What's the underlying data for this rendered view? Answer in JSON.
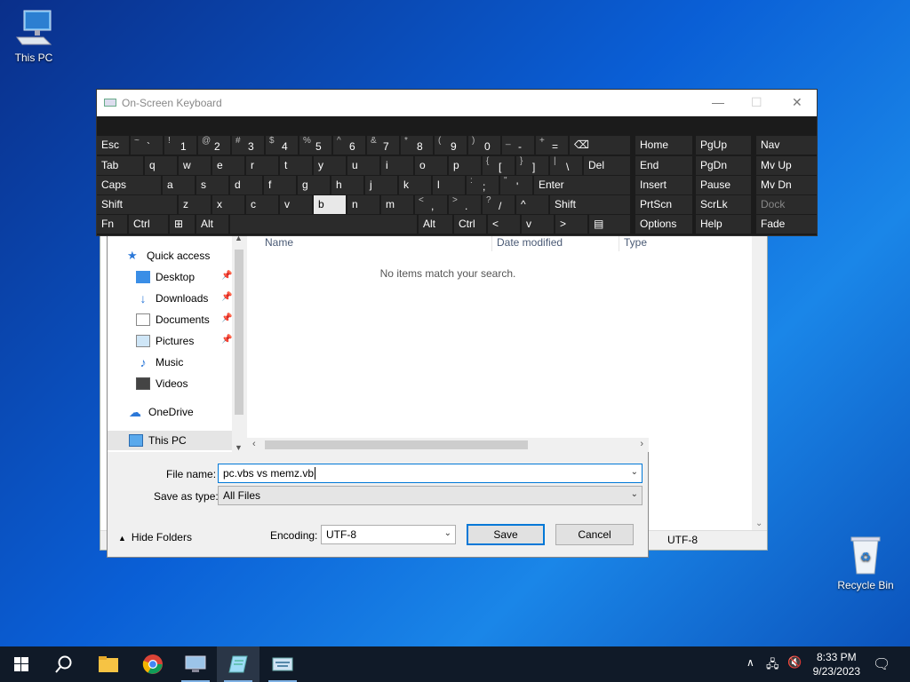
{
  "desktop": {
    "this_pc_label": "This PC",
    "recycle_bin_label": "Recycle Bin"
  },
  "notepad": {
    "encoding": "UTF-8"
  },
  "dialog": {
    "columns": {
      "name": "Name",
      "date_modified": "Date modified",
      "type": "Type"
    },
    "empty_message": "No items match your search.",
    "nav": {
      "quick_access": "Quick access",
      "desktop": "Desktop",
      "downloads": "Downloads",
      "documents": "Documents",
      "pictures": "Pictures",
      "music": "Music",
      "videos": "Videos",
      "onedrive": "OneDrive",
      "this_pc": "This PC"
    },
    "file_name_label": "File name:",
    "file_name_value": "pc.vbs vs memz.vb",
    "save_as_type_label": "Save as type:",
    "save_as_type_value": "All Files",
    "hide_folders": "Hide Folders",
    "encoding_label": "Encoding:",
    "encoding_value": "UTF-8",
    "save_button": "Save",
    "cancel_button": "Cancel"
  },
  "osk": {
    "title": "On-Screen Keyboard",
    "row1": [
      {
        "sub": "",
        "main": "Esc"
      },
      {
        "sub": "~",
        "main": "`"
      },
      {
        "sub": "!",
        "main": "1"
      },
      {
        "sub": "@",
        "main": "2"
      },
      {
        "sub": "#",
        "main": "3"
      },
      {
        "sub": "$",
        "main": "4"
      },
      {
        "sub": "%",
        "main": "5"
      },
      {
        "sub": "^",
        "main": "6"
      },
      {
        "sub": "&",
        "main": "7"
      },
      {
        "sub": "*",
        "main": "8"
      },
      {
        "sub": "(",
        "main": "9"
      },
      {
        "sub": ")",
        "main": "0"
      },
      {
        "sub": "_",
        "main": "-"
      },
      {
        "sub": "+",
        "main": "="
      },
      {
        "sub": "",
        "main": "⌫"
      }
    ],
    "row2": [
      "Tab",
      "q",
      "w",
      "e",
      "r",
      "t",
      "y",
      "u",
      "i",
      "o",
      "p",
      "[",
      "]",
      "\\",
      "Del"
    ],
    "row2_subs": [
      "",
      "",
      "",
      "",
      "",
      "",
      "",
      "",
      "",
      "",
      "",
      "{",
      "}",
      "|",
      ""
    ],
    "row3": [
      "Caps",
      "a",
      "s",
      "d",
      "f",
      "g",
      "h",
      "j",
      "k",
      "l",
      ";",
      "'",
      "Enter"
    ],
    "row3_subs": [
      "",
      "",
      "",
      "",
      "",
      "",
      "",
      "",
      "",
      "",
      ":",
      "\"",
      ""
    ],
    "row4": [
      "Shift",
      "z",
      "x",
      "c",
      "v",
      "b",
      "n",
      "m",
      ",",
      ".",
      "/",
      "^",
      "Shift"
    ],
    "row4_subs": [
      "",
      "",
      "",
      "",
      "",
      "",
      "",
      "",
      "<",
      ">",
      "?",
      "",
      ""
    ],
    "row5": [
      "Fn",
      "Ctrl",
      "⊞",
      "Alt",
      "",
      "Alt",
      "Ctrl",
      "<",
      "v",
      ">",
      "▤"
    ],
    "side_col1": [
      "Home",
      "End",
      "Insert",
      "PrtScn",
      "Options"
    ],
    "side_col2": [
      "PgUp",
      "PgDn",
      "Pause",
      "ScrLk",
      "Help"
    ],
    "side_col3": [
      "Nav",
      "Mv Up",
      "Mv Dn",
      "Dock",
      "Fade"
    ]
  },
  "taskbar": {
    "time": "8:33 PM",
    "date": "9/23/2023"
  }
}
